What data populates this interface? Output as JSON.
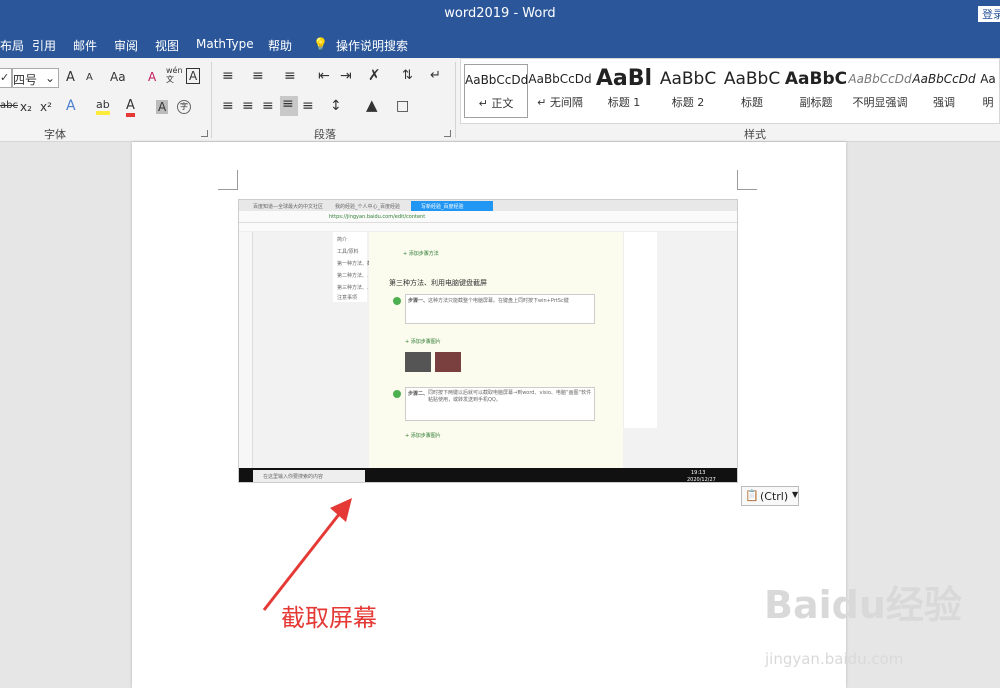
{
  "titlebar": {
    "title": "word2019  -  Word",
    "login": "登录"
  },
  "menu": {
    "layout": "布局",
    "references": "引用",
    "mailings": "邮件",
    "review": "审阅",
    "view": "视图",
    "mathtype": "MathType",
    "help": "帮助",
    "tell_me": "操作说明搜索"
  },
  "font_group": {
    "size": "四号",
    "label": "字体",
    "grow": "A",
    "shrink": "A",
    "case": "Aa",
    "clear": "A",
    "phonetic": "wén\n文",
    "border": "A",
    "strike": "abc",
    "sub": "x₂",
    "sup": "x²",
    "effects": "A",
    "highlight": "ab",
    "color": "A",
    "shade": "A",
    "enclose": "字"
  },
  "para_group": {
    "label": "段落"
  },
  "styles": {
    "label": "样式",
    "items": [
      {
        "preview": "AaBbCcDd",
        "name": "↵ 正文"
      },
      {
        "preview": "AaBbCcDd",
        "name": "↵ 无间隔"
      },
      {
        "preview": "AaBl",
        "name": "标题 1"
      },
      {
        "preview": "AaBbC",
        "name": "标题 2"
      },
      {
        "preview": "AaBbC",
        "name": "标题"
      },
      {
        "preview": "AaBbC",
        "name": "副标题"
      },
      {
        "preview": "AaBbCcDd",
        "name": "不明显强调"
      },
      {
        "preview": "AaBbCcDd",
        "name": "强调"
      },
      {
        "preview": "Aa",
        "name": "明"
      }
    ]
  },
  "screenshot": {
    "tab1": "百度知道—全球最大的中文社区",
    "tab2": "我的经验_个人中心_百度经验",
    "tab3": "写新经验_百度经验",
    "url": "https://jingyan.baidu.com/edit/content",
    "heading": "第三种方法、利用电脑键盘截屏",
    "step1_label": "步骤一、",
    "step1": "这种方法只能截整个电脑屏幕。在键盘上同时按下win+PrtSc键",
    "step2_label": "步骤二、",
    "step2": "同时按下两键以后就可以截取电脑屏幕→到word、visio、电脑“画图”软件粘贴使用，或转发送到手机QQ。",
    "add_image": "+ 添加步骤图片",
    "add_method": "+ 添加步骤方法",
    "outline": [
      "简介",
      "工具/原料",
      "第一种方法、截屏",
      "第二种方法、…",
      "第三种方法、…",
      "注意事项"
    ],
    "taskbar_search": "在这里输入你要搜索的内容",
    "time": "19:13",
    "date": "2020/12/27"
  },
  "paste_button": {
    "label": "(Ctrl)"
  },
  "annotation": {
    "text": "截取屏幕"
  },
  "watermark": {
    "brand": "Baidu经验",
    "url": "jingyan.baidu.com"
  }
}
